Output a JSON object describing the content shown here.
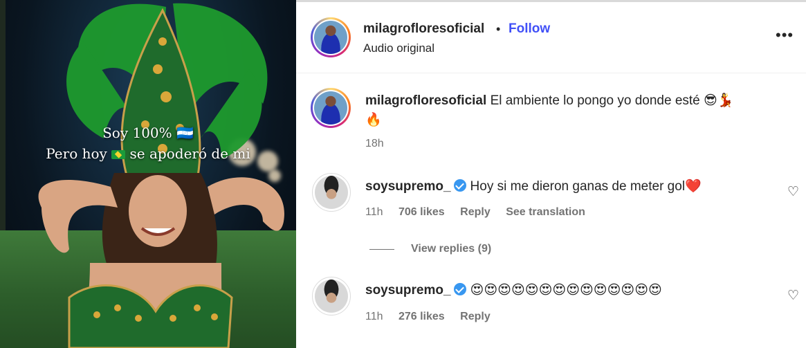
{
  "media": {
    "caption_line1": "Soy 100% 🇭🇳",
    "caption_line2_a": "Pero hoy",
    "caption_line2_b": "se apoderó de mi"
  },
  "header": {
    "username": "milagrofloresoficial",
    "separator": "•",
    "follow_label": "Follow",
    "subtitle": "Audio original",
    "more_label": "•••"
  },
  "post": {
    "username": "milagrofloresoficial",
    "text": "El ambiente lo pongo yo donde esté 😎💃",
    "text_line2": "🔥",
    "time": "18h"
  },
  "comments": [
    {
      "username": "soysupremo_",
      "text": "Hoy si me dieron ganas de meter gol❤️",
      "time": "11h",
      "likes": "706 likes",
      "reply_label": "Reply",
      "translation_label": "See translation",
      "view_replies": "View replies (9)"
    },
    {
      "username": "soysupremo_",
      "text": "😍😍😍😍😍😍😍😍😍😍😍😍😍😍",
      "time": "11h",
      "likes": "276 likes",
      "reply_label": "Reply"
    }
  ],
  "icons": {
    "heart": "♡",
    "more": "more-options-icon",
    "verified": "verified-badge-icon"
  },
  "colors": {
    "follow": "#4150f7",
    "meta": "#737373",
    "verified": "#3897f0"
  }
}
